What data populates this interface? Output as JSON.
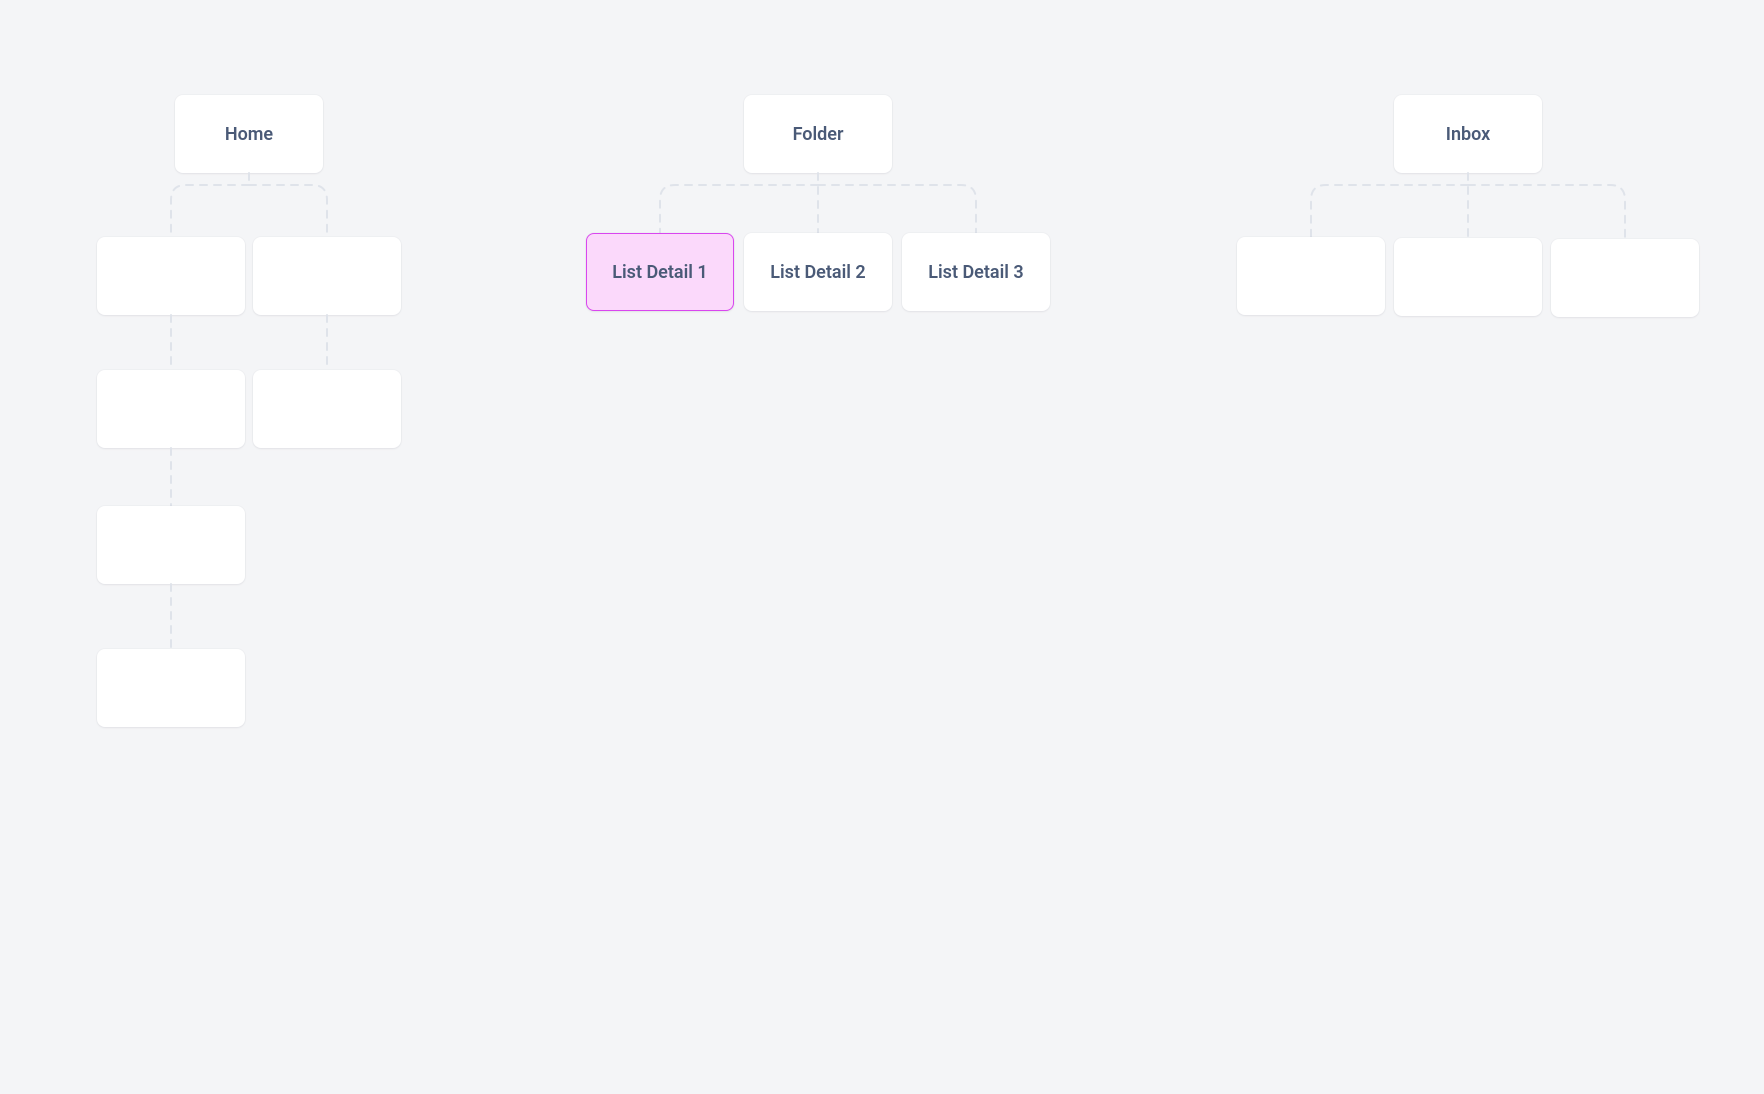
{
  "colors": {
    "background": "#f4f5f7",
    "card_bg": "#ffffff",
    "text": "#4a5a77",
    "connector": "#dfe3ea",
    "selected_bg": "#fbd9fb",
    "selected_border": "#d946ef"
  },
  "nodes": {
    "home": {
      "label": "Home"
    },
    "folder": {
      "label": "Folder"
    },
    "inbox": {
      "label": "Inbox"
    },
    "list_detail_1": {
      "label": "List  Detail 1",
      "selected": true
    },
    "list_detail_2": {
      "label": "List  Detail 2"
    },
    "list_detail_3": {
      "label": "List Detail 3"
    },
    "home_child_1": {
      "label": ""
    },
    "home_child_2": {
      "label": ""
    },
    "home_child_3": {
      "label": ""
    },
    "home_child_4": {
      "label": ""
    },
    "home_child_5": {
      "label": ""
    },
    "home_child_6": {
      "label": ""
    },
    "inbox_child_1": {
      "label": ""
    },
    "inbox_child_2": {
      "label": ""
    },
    "inbox_child_3": {
      "label": ""
    }
  }
}
